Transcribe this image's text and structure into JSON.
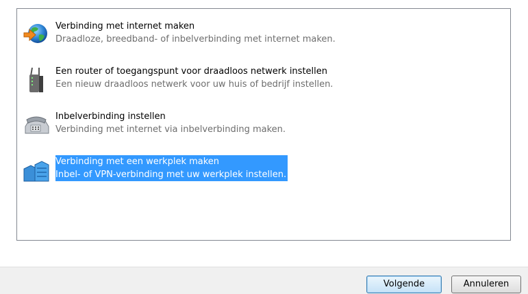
{
  "options": [
    {
      "title": "Verbinding met internet maken",
      "description": "Draadloze, breedband- of inbelverbinding met internet maken.",
      "icon": "globe-arrow-icon",
      "selected": false
    },
    {
      "title": "Een router of toegangspunt voor draadloos netwerk instellen",
      "description": "Een nieuw draadloos netwerk voor uw huis of bedrijf instellen.",
      "icon": "router-icon",
      "selected": false
    },
    {
      "title": "Inbelverbinding instellen",
      "description": "Verbinding met internet via inbelverbinding maken.",
      "icon": "telephone-icon",
      "selected": false
    },
    {
      "title": "Verbinding met een werkplek maken",
      "description": "Inbel- of VPN-verbinding met uw werkplek instellen.",
      "icon": "workplace-building-icon",
      "selected": true
    }
  ],
  "buttons": {
    "next_label": "Volgende",
    "cancel_label": "Annuleren"
  },
  "colors": {
    "selection": "#3399ff",
    "description_text": "#6d6d6d",
    "footer_background": "#f0f0f0"
  }
}
